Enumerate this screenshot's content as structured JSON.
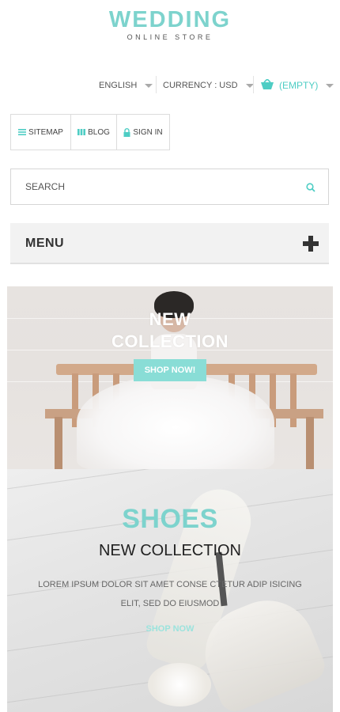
{
  "logo": {
    "title": "WEDDING",
    "subtitle": "ONLINE STORE"
  },
  "topbar": {
    "language": "ENGLISH",
    "currency": "CURRENCY : USD",
    "cart": "(EMPTY)"
  },
  "nav": {
    "sitemap": "SITEMAP",
    "blog": "BLOG",
    "signin": "SIGN IN"
  },
  "search": {
    "placeholder": "SEARCH"
  },
  "menu": {
    "label": "MENU"
  },
  "banner1": {
    "title_line1": "NEW",
    "title_line2": "COLLECTION",
    "button": "SHOP NOW!"
  },
  "banner2": {
    "title": "SHOES",
    "subtitle": "NEW COLLECTION",
    "description": "LOREM IPSUM DOLOR SIT AMET CONSE CTETUR ADIP ISICING ELIT, SED DO EIUSMOD",
    "link": "SHOP NOW"
  },
  "colors": {
    "accent": "#7dd3cd",
    "cart": "#4ecdc4",
    "button": "#89ddd6"
  }
}
